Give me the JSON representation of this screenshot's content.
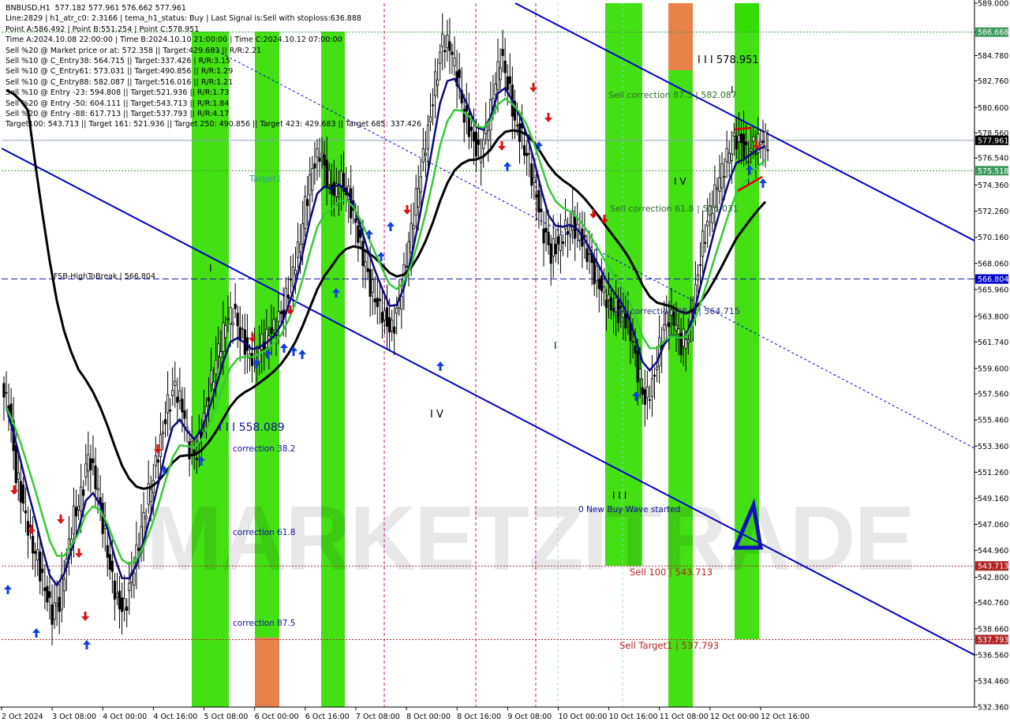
{
  "header": {
    "lines": [
      "BNBUSD,H1  577.182 577.961 576.662 577.961",
      "Line:2829 | h1_atr_c0: 2.3166 | tema_h1_status: Buy | Last Signal is:Sell with stoploss:636.888",
      "Point A:586.492 | Point B:551.254 | Point C:578.951",
      "Time A:2024.10.08 22:00:00 | Time B:2024.10.10 21:00:00 | Time C:2024.10.12 07:00:00",
      "Sell %20 @ Market price or at: 572.358 || Target:429.683 || R/R:2.21",
      "Sell %10 @ C_Entry38: 564.715 || Target:337.426 | R/R:3.15",
      "Sell %10 @ C_Entry61: 573.031 || Target:490.856 || R/R:1.29",
      "Sell %10 @ C_Entry88: 582.087 || Target:516.016 || R/R:1.21",
      "Sell %10 @ Entry -23: 594.808 || Target:521.936 || R/R:1.73",
      "Sell %20 @ Entry -50: 604.111 || Target:543.713 || R/R:1.84",
      "Sell %20 @ Entry -88: 617.713 || Target:537.793 || R/R:4.17",
      "Target100: 543.713 || Target 161: 521.936 || Target 250: 490.856 || Target 423: 429.683 || Target 685: 337.426"
    ]
  },
  "colors": {
    "green_band": "#33dd00",
    "orange_band": "#e8824a",
    "axis_text": "#000000",
    "price_tag_green": "#3c9a5f",
    "price_tag_blue": "#0000cd",
    "price_tag_red": "#b22222",
    "channel": "#0000cd",
    "ma_black": "#000000",
    "ma_navy": "#0a0a80",
    "ma_green": "#33cc33",
    "candle": "#000000",
    "signal_up": "#1040e0",
    "signal_down": "#e01010"
  },
  "watermark": "MARKETZITRADE",
  "chart_data": {
    "type": "candlestick",
    "symbol": "BNBUSD",
    "timeframe": "H1",
    "ylim": [
      532.36,
      589.0
    ],
    "y_ticks": [
      "589.000",
      "586.668",
      "584.780",
      "582.760",
      "580.600",
      "578.560",
      "576.540",
      "574.360",
      "572.260",
      "570.160",
      "568.060",
      "566.804",
      "565.960",
      "563.800",
      "561.740",
      "559.600",
      "557.560",
      "555.460",
      "553.360",
      "551.260",
      "549.160",
      "547.060",
      "544.960",
      "542.800",
      "540.760",
      "538.660",
      "536.560",
      "534.460",
      "532.360"
    ],
    "x_labels": [
      "2 Oct 2024",
      "3 Oct 08:00",
      "4 Oct 00:00",
      "4 Oct 16:00",
      "5 Oct 08:00",
      "6 Oct 00:00",
      "6 Oct 16:00",
      "7 Oct 08:00",
      "8 Oct 00:00",
      "8 Oct 16:00",
      "9 Oct 08:00",
      "10 Oct 00:00",
      "10 Oct 16:00",
      "11 Oct 08:00",
      "12 Oct 00:00",
      "12 Oct 16:00"
    ],
    "price_tags": [
      {
        "label": "586.668",
        "value": 586.668,
        "kind": "green"
      },
      {
        "label": "577.961",
        "value": 577.961,
        "kind": "black"
      },
      {
        "label": "575.518",
        "value": 575.518,
        "kind": "green"
      },
      {
        "label": "566.804",
        "value": 566.804,
        "kind": "blue"
      },
      {
        "label": "543.713",
        "value": 543.713,
        "kind": "red"
      },
      {
        "label": "537.793",
        "value": 537.793,
        "kind": "red"
      }
    ],
    "levels": [
      {
        "name": "target-586",
        "value": 586.668,
        "style": "green-dotted"
      },
      {
        "name": "current-price",
        "value": 577.961,
        "style": "gray-solid"
      },
      {
        "name": "target-575",
        "value": 575.518,
        "style": "green-dotted"
      },
      {
        "name": "fsb-high",
        "value": 566.804,
        "style": "blue-dashed"
      },
      {
        "name": "sell-100",
        "value": 543.713,
        "style": "red-dotted"
      },
      {
        "name": "sell-target1",
        "value": 537.793,
        "style": "red-dotted"
      }
    ],
    "annotations": [
      {
        "text": "I I I 578.951",
        "kind": "wave"
      },
      {
        "text": "Sell correction 87.5 | 582.087",
        "kind": "level"
      },
      {
        "text": "Target1",
        "kind": "target"
      },
      {
        "text": "I V",
        "kind": "wave"
      },
      {
        "text": "Sell correction 61.8 | 573.031",
        "kind": "level"
      },
      {
        "text": "FSB-HighToBreak | 566.804",
        "kind": "level"
      },
      {
        "text": "Sell correction 38.2 | 564.715",
        "kind": "level"
      },
      {
        "text": "I I I 558.089",
        "kind": "wave"
      },
      {
        "text": "correction 38.2",
        "kind": "fib"
      },
      {
        "text": "I V",
        "kind": "wave"
      },
      {
        "text": "0 New Buy Wave started",
        "kind": "note"
      },
      {
        "text": "correction 61.8",
        "kind": "fib"
      },
      {
        "text": "Sell 100 | 543.713",
        "kind": "sell"
      },
      {
        "text": "correction 87.5",
        "kind": "fib"
      },
      {
        "text": "Sell Target1 | 537.793",
        "kind": "sell"
      },
      {
        "text": "I",
        "kind": "wave"
      },
      {
        "text": "I",
        "kind": "wave"
      },
      {
        "text": "I",
        "kind": "wave"
      },
      {
        "text": "I I I",
        "kind": "wave"
      }
    ],
    "series": [
      {
        "name": "close",
        "values": [
          556.5,
          551.2,
          548.8,
          546.1,
          544.2,
          541.6,
          539.7,
          540.9,
          544.5,
          547.9,
          549.2,
          552.4,
          550.5,
          547.2,
          543.8,
          541.0,
          540.2,
          542.7,
          545.4,
          548.6,
          551.1,
          553.9,
          556.6,
          558.0,
          556.4,
          553.2,
          552.9,
          555.8,
          558.6,
          560.9,
          563.2,
          564.1,
          562.6,
          561.0,
          560.4,
          561.6,
          562.2,
          563.0,
          564.4,
          566.9,
          569.1,
          572.6,
          575.5,
          576.9,
          575.1,
          573.8,
          574.9,
          573.4,
          571.0,
          568.4,
          566.3,
          565.0,
          563.8,
          562.6,
          564.8,
          568.2,
          572.0,
          575.6,
          578.9,
          582.6,
          585.9,
          585.4,
          583.2,
          580.1,
          578.6,
          576.8,
          578.5,
          581.4,
          584.6,
          582.8,
          579.6,
          578.2,
          576.1,
          573.3,
          570.4,
          568.9,
          569.8,
          570.9,
          571.4,
          570.2,
          568.8,
          567.3,
          566.2,
          565.0,
          564.4,
          563.8,
          562.3,
          559.4,
          557.2,
          558.4,
          561.2,
          563.6,
          563.4,
          561.6,
          562.5,
          566.1,
          569.8,
          572.0,
          574.3,
          575.9,
          577.6,
          578.3,
          576.8,
          577.5,
          577.8,
          577.9
        ]
      }
    ]
  }
}
